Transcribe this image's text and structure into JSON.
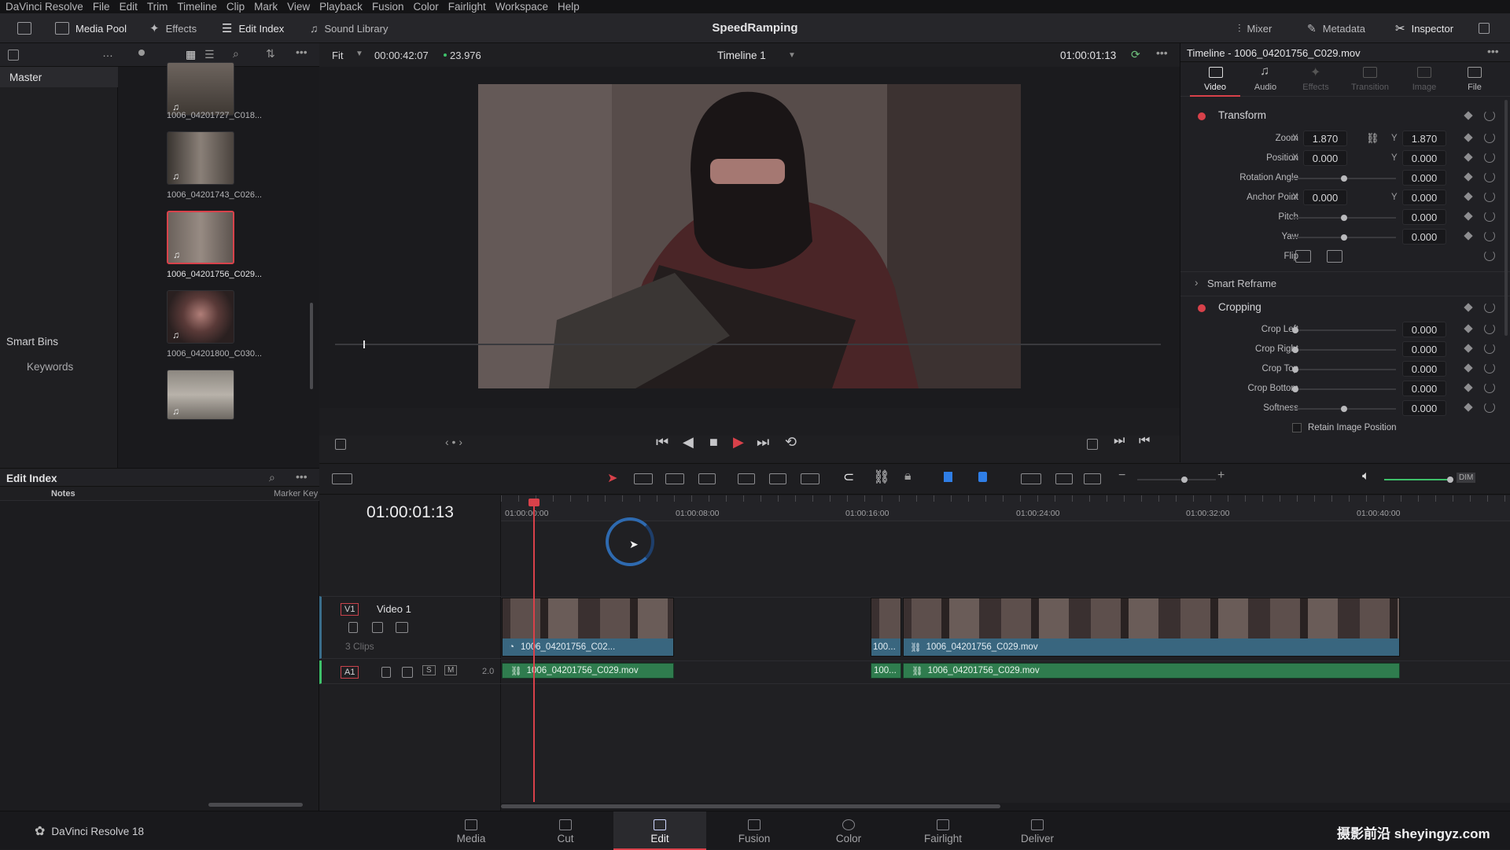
{
  "menu": [
    "DaVinci Resolve",
    "File",
    "Edit",
    "Trim",
    "Timeline",
    "Clip",
    "Mark",
    "View",
    "Playback",
    "Fusion",
    "Color",
    "Fairlight",
    "Workspace",
    "Help"
  ],
  "toolbar": {
    "media_pool": "Media Pool",
    "effects": "Effects",
    "edit_index": "Edit Index",
    "sound_library": "Sound Library",
    "project_title": "SpeedRamping",
    "mixer": "Mixer",
    "metadata": "Metadata",
    "inspector": "Inspector"
  },
  "bins": {
    "master": "Master",
    "smart_bins": "Smart Bins",
    "keywords": "Keywords"
  },
  "clips": [
    {
      "name": "1006_04201727_C018..."
    },
    {
      "name": "1006_04201743_C026..."
    },
    {
      "name": "1006_04201756_C029..."
    },
    {
      "name": "1006_04201800_C030..."
    }
  ],
  "edit_index": {
    "title": "Edit Index",
    "col_notes": "Notes",
    "col_marker": "Marker Key"
  },
  "viewer": {
    "fit": "Fit",
    "duration": "00:00:42:07",
    "fps": "23.976",
    "timeline_name": "Timeline 1",
    "timecode": "01:00:01:13"
  },
  "inspector": {
    "header": "Timeline - 1006_04201756_C029.mov",
    "tabs": [
      "Video",
      "Audio",
      "Effects",
      "Transition",
      "Image",
      "File"
    ],
    "transform": {
      "title": "Transform",
      "zoom_label": "Zoom",
      "zoom_x": "1.870",
      "zoom_y": "1.870",
      "position_label": "Position",
      "position_x": "0.000",
      "position_y": "0.000",
      "rotation_label": "Rotation Angle",
      "rotation": "0.000",
      "anchor_label": "Anchor Point",
      "anchor_x": "0.000",
      "anchor_y": "0.000",
      "pitch_label": "Pitch",
      "pitch": "0.000",
      "yaw_label": "Yaw",
      "yaw": "0.000",
      "flip_label": "Flip"
    },
    "smart_reframe": "Smart Reframe",
    "cropping": {
      "title": "Cropping",
      "crop_left_label": "Crop Left",
      "crop_left": "0.000",
      "crop_right_label": "Crop Right",
      "crop_right": "0.000",
      "crop_top_label": "Crop Top",
      "crop_top": "0.000",
      "crop_bottom_label": "Crop Bottom",
      "crop_bottom": "0.000",
      "softness_label": "Softness",
      "softness": "0.000",
      "retain_label": "Retain Image Position"
    },
    "axis_x": "X",
    "axis_y": "Y"
  },
  "timeline": {
    "timecode": "01:00:01:13",
    "ruler": [
      "01:00:00:00",
      "01:00:08:00",
      "01:00:16:00",
      "01:00:24:00",
      "01:00:32:00",
      "01:00:40:00"
    ],
    "v1_label": "V1",
    "v1_name": "Video 1",
    "v1_clips_count": "3 Clips",
    "a1_label": "A1",
    "a1_level": "2.0",
    "solo": "S",
    "mute": "M",
    "clip1_video": "1006_04201756_C02...",
    "clip2_video": "100...",
    "clip3_video": "1006_04201756_C029.mov",
    "clip1_audio": "1006_04201756_C029.mov",
    "clip2_audio": "100...",
    "clip3_audio": "1006_04201756_C029.mov",
    "dim": "DIM"
  },
  "pages": [
    "Media",
    "Cut",
    "Edit",
    "Fusion",
    "Color",
    "Fairlight",
    "Deliver"
  ],
  "active_page": "Edit",
  "app_name": "DaVinci Resolve 18",
  "watermark": "摄影前沿 sheyingyz.com",
  "colors": {
    "accent": "#d8414a",
    "video_clip": "#39667f",
    "audio_clip": "#2f7c4e"
  }
}
